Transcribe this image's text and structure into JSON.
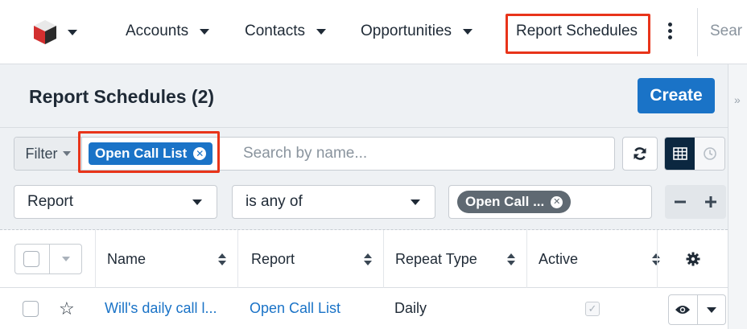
{
  "nav": {
    "items": [
      {
        "label": "Accounts"
      },
      {
        "label": "Contacts"
      },
      {
        "label": "Opportunities"
      }
    ],
    "active_module": "Report Schedules",
    "search_placeholder": "Sear",
    "icons": {
      "logo": "cube-logo-icon",
      "more": "kebab-icon"
    }
  },
  "header": {
    "title": "Report Schedules (2)",
    "create_label": "Create"
  },
  "filter": {
    "dropdown_label": "Filter",
    "active_filter": "Open Call List",
    "search_placeholder": "Search by name..."
  },
  "criteria": {
    "field": "Report",
    "operator": "is any of",
    "value_pill": "Open Call ..."
  },
  "table": {
    "columns": [
      "Name",
      "Report",
      "Repeat Type",
      "Active"
    ],
    "rows": [
      {
        "name": "Will's daily call l...",
        "report": "Open Call List",
        "repeat_type": "Daily",
        "active": false
      }
    ]
  },
  "colors": {
    "accent": "#1a73c7",
    "highlight": "#e8341a",
    "panel_bg": "#eef1f4",
    "active_toggle": "#0b2740"
  }
}
